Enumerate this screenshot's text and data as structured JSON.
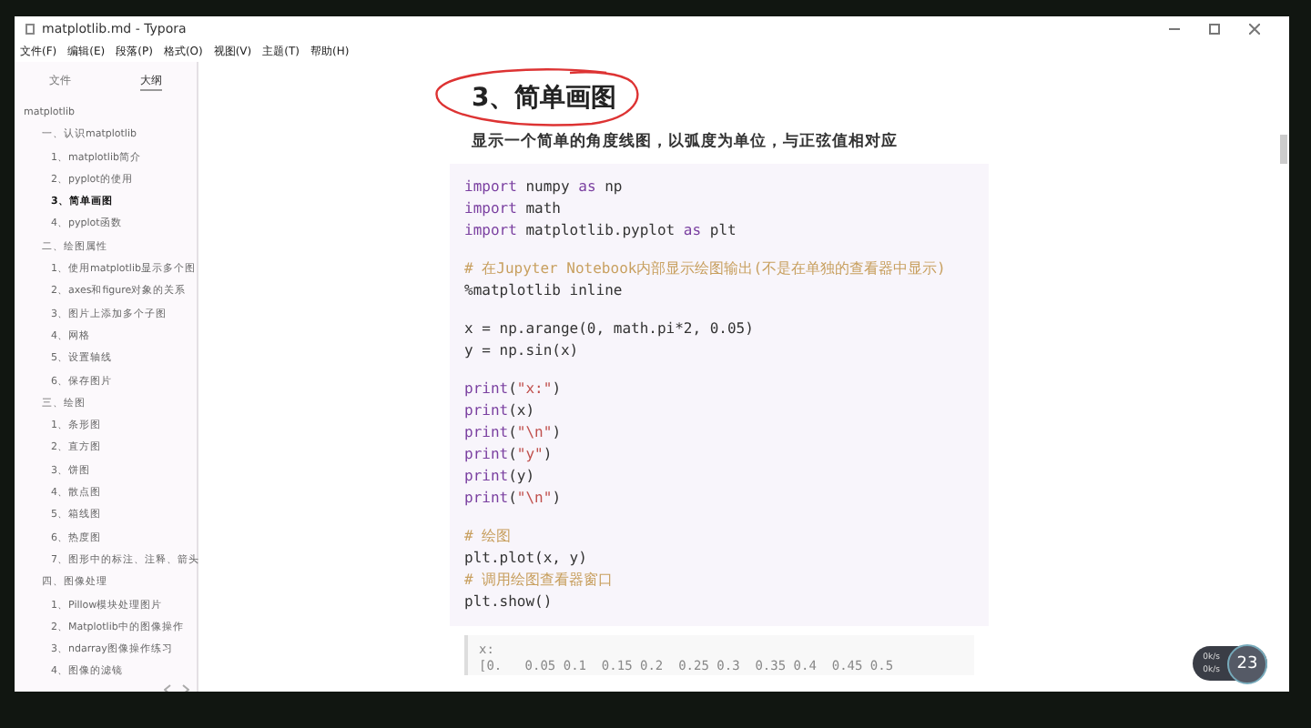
{
  "window": {
    "title": "matplotlib.md - Typora"
  },
  "menu": [
    "文件(F)",
    "编辑(E)",
    "段落(P)",
    "格式(O)",
    "视图(V)",
    "主题(T)",
    "帮助(H)"
  ],
  "sidebar": {
    "tabs": [
      {
        "label": "文件",
        "selected": false
      },
      {
        "label": "大纲",
        "selected": true
      }
    ],
    "outline": [
      {
        "label": "matplotlib",
        "selected": false,
        "children": [
          {
            "label": "一、认识matplotlib",
            "selected": false,
            "children": [
              {
                "label": "1、matplotlib简介",
                "selected": false
              },
              {
                "label": "2、pyplot的使用",
                "selected": false
              },
              {
                "label": "3、简单画图",
                "selected": true
              },
              {
                "label": "4、pyplot函数",
                "selected": false
              }
            ]
          },
          {
            "label": "二、绘图属性",
            "selected": false,
            "children": [
              {
                "label": "1、使用matplotlib显示多个图",
                "selected": false
              },
              {
                "label": "2、axes和figure对象的关系",
                "selected": false
              },
              {
                "label": "3、图片上添加多个子图",
                "selected": false
              },
              {
                "label": "4、网格",
                "selected": false
              },
              {
                "label": "5、设置轴线",
                "selected": false
              },
              {
                "label": "6、保存图片",
                "selected": false
              }
            ]
          },
          {
            "label": "三、绘图",
            "selected": false,
            "children": [
              {
                "label": "1、条形图",
                "selected": false
              },
              {
                "label": "2、直方图",
                "selected": false
              },
              {
                "label": "3、饼图",
                "selected": false
              },
              {
                "label": "4、散点图",
                "selected": false
              },
              {
                "label": "5、箱线图",
                "selected": false
              },
              {
                "label": "6、热度图",
                "selected": false
              },
              {
                "label": "7、图形中的标注、注释、箭头",
                "selected": false
              }
            ]
          },
          {
            "label": "四、图像处理",
            "selected": false,
            "children": [
              {
                "label": "1、Pillow模块处理图片",
                "selected": false
              },
              {
                "label": "2、Matplotlib中的图像操作",
                "selected": false
              },
              {
                "label": "3、ndarray图像操作练习",
                "selected": false
              },
              {
                "label": "4、图像的滤镜",
                "selected": false
              }
            ]
          }
        ]
      }
    ]
  },
  "document": {
    "heading": "3、简单画图",
    "paragraph": "显示一个简单的角度线图，以弧度为单位，与正弦值相对应",
    "code": [
      [
        [
          {
            "text": "import",
            "kind": "keyword"
          },
          {
            "text": " numpy ",
            "kind": "plain"
          },
          {
            "text": "as",
            "kind": "keyword"
          },
          {
            "text": " np",
            "kind": "plain"
          }
        ],
        [
          {
            "text": "import",
            "kind": "keyword"
          },
          {
            "text": " math",
            "kind": "plain"
          }
        ],
        [
          {
            "text": "import",
            "kind": "keyword"
          },
          {
            "text": " matplotlib.pyplot ",
            "kind": "plain"
          },
          {
            "text": "as",
            "kind": "keyword"
          },
          {
            "text": " plt",
            "kind": "plain"
          }
        ]
      ],
      [
        [
          {
            "text": "# 在Jupyter Notebook内部显示绘图输出(不是在单独的查看器中显示)",
            "kind": "comment"
          }
        ],
        [
          {
            "text": "%matplotlib inline",
            "kind": "plain"
          }
        ]
      ],
      [
        [
          {
            "text": "x = np.arange(0, math.pi*2, 0.05)",
            "kind": "plain"
          }
        ],
        [
          {
            "text": "y = np.sin(x)",
            "kind": "plain"
          }
        ]
      ],
      [
        [
          {
            "text": "print",
            "kind": "builtin"
          },
          {
            "text": "(",
            "kind": "plain"
          },
          {
            "text": "\"x:\"",
            "kind": "string"
          },
          {
            "text": ")",
            "kind": "plain"
          }
        ],
        [
          {
            "text": "print",
            "kind": "builtin"
          },
          {
            "text": "(x)",
            "kind": "plain"
          }
        ],
        [
          {
            "text": "print",
            "kind": "builtin"
          },
          {
            "text": "(",
            "kind": "plain"
          },
          {
            "text": "\"\\n\"",
            "kind": "string"
          },
          {
            "text": ")",
            "kind": "plain"
          }
        ],
        [
          {
            "text": "print",
            "kind": "builtin"
          },
          {
            "text": "(",
            "kind": "plain"
          },
          {
            "text": "\"y\"",
            "kind": "string"
          },
          {
            "text": ")",
            "kind": "plain"
          }
        ],
        [
          {
            "text": "print",
            "kind": "builtin"
          },
          {
            "text": "(y)",
            "kind": "plain"
          }
        ],
        [
          {
            "text": "print",
            "kind": "builtin"
          },
          {
            "text": "(",
            "kind": "plain"
          },
          {
            "text": "\"\\n\"",
            "kind": "string"
          },
          {
            "text": ")",
            "kind": "plain"
          }
        ]
      ],
      [
        [
          {
            "text": "# 绘图",
            "kind": "comment"
          }
        ],
        [
          {
            "text": "plt.plot(x, y)",
            "kind": "plain"
          }
        ],
        [
          {
            "text": "# 调用绘图查看器窗口",
            "kind": "comment"
          }
        ],
        [
          {
            "text": "plt.show()",
            "kind": "plain"
          }
        ]
      ]
    ],
    "output": [
      "x:",
      "[0.   0.05 0.1  0.15 0.2  0.25 0.3  0.35 0.4  0.45 0.5"
    ]
  },
  "overlay": {
    "speeds": [
      "0k/s",
      "0k/s"
    ],
    "badge": "23"
  }
}
